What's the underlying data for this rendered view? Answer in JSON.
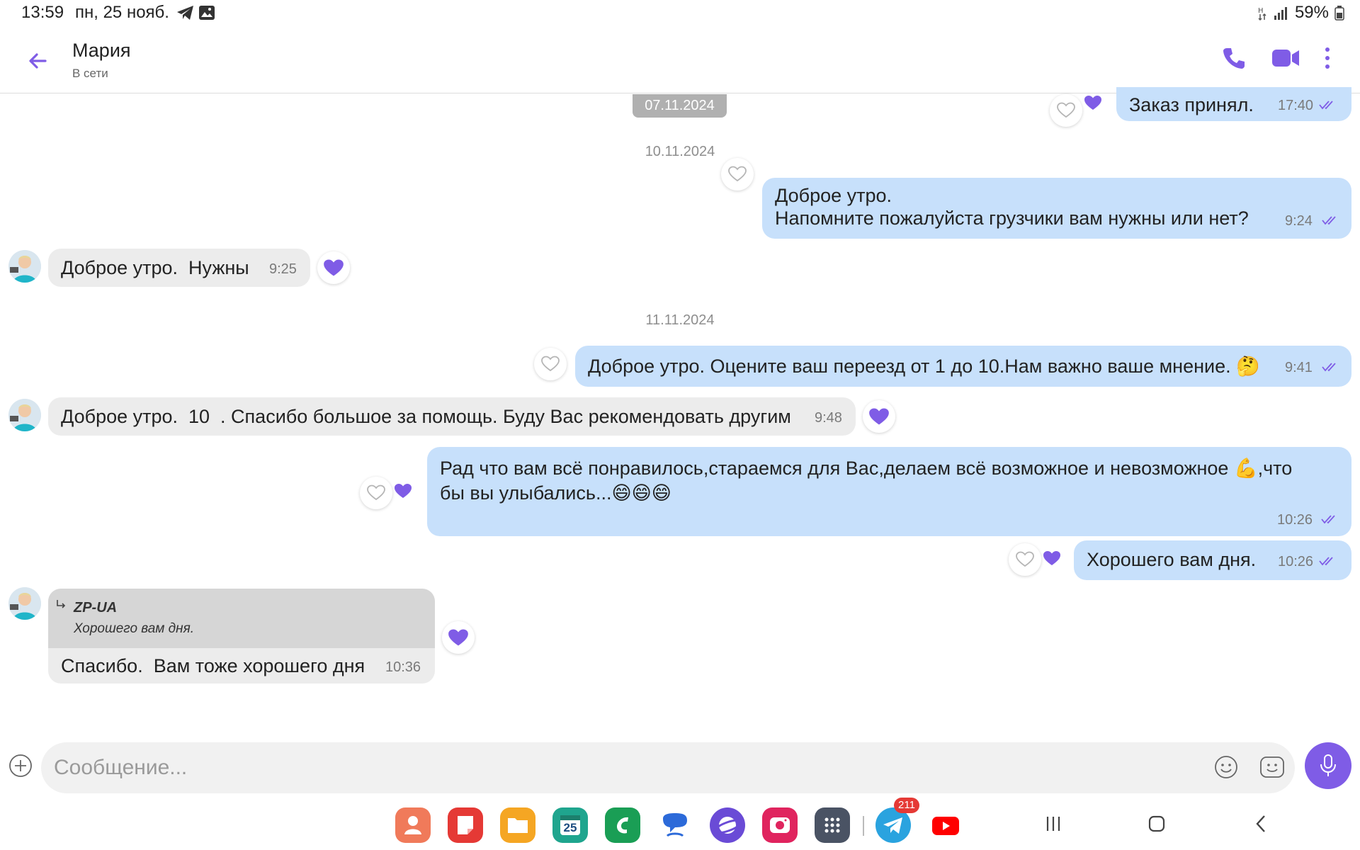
{
  "status_bar": {
    "time": "13:59",
    "date": "пн, 25 нояб.",
    "battery": "59%"
  },
  "header": {
    "contact_name": "Мария",
    "contact_status": "В сети"
  },
  "dates": {
    "d1": "07.11.2024",
    "d2": "10.11.2024",
    "d3": "11.11.2024"
  },
  "messages": [
    {
      "dir": "out",
      "text": "Заказ принял.",
      "time": "17:40"
    },
    {
      "dir": "out",
      "line1": "Доброе утро.",
      "line2": "Напомните пожалуйста грузчики вам нужны или нет?",
      "time": "9:24"
    },
    {
      "dir": "in",
      "text": "Доброе утро.  Нужны",
      "time": "9:25"
    },
    {
      "dir": "out",
      "text": "Доброе утро. Оцените ваш переезд от 1 до 10.Нам важно ваше мнение. 🤔",
      "time": "9:41"
    },
    {
      "dir": "in",
      "text": "Доброе утро.  10  . Спасибо большое за помощь. Буду Вас рекомендовать другим",
      "time": "9:48"
    },
    {
      "dir": "out",
      "line1": "Рад что вам всё понравилось,стараемся для Вас,делаем всё возможное и невозможное 💪,что",
      "line2": "бы вы улыбались...😄😄😄",
      "time": "10:26"
    },
    {
      "dir": "out",
      "text": "Хорошего вам дня.",
      "time": "10:26"
    },
    {
      "dir": "in",
      "quote_author": "ZP-UA",
      "quote_text": "Хорошего вам дня.",
      "text": "Спасибо.  Вам тоже хорошего дня",
      "time": "10:36"
    }
  ],
  "input": {
    "placeholder": "Сообщение..."
  },
  "dock": {
    "calendar_day": "25",
    "telegram_badge": "211"
  },
  "colors": {
    "accent": "#7f5ce6",
    "out_bubble": "#c7e0fb",
    "in_bubble": "#ececec"
  }
}
